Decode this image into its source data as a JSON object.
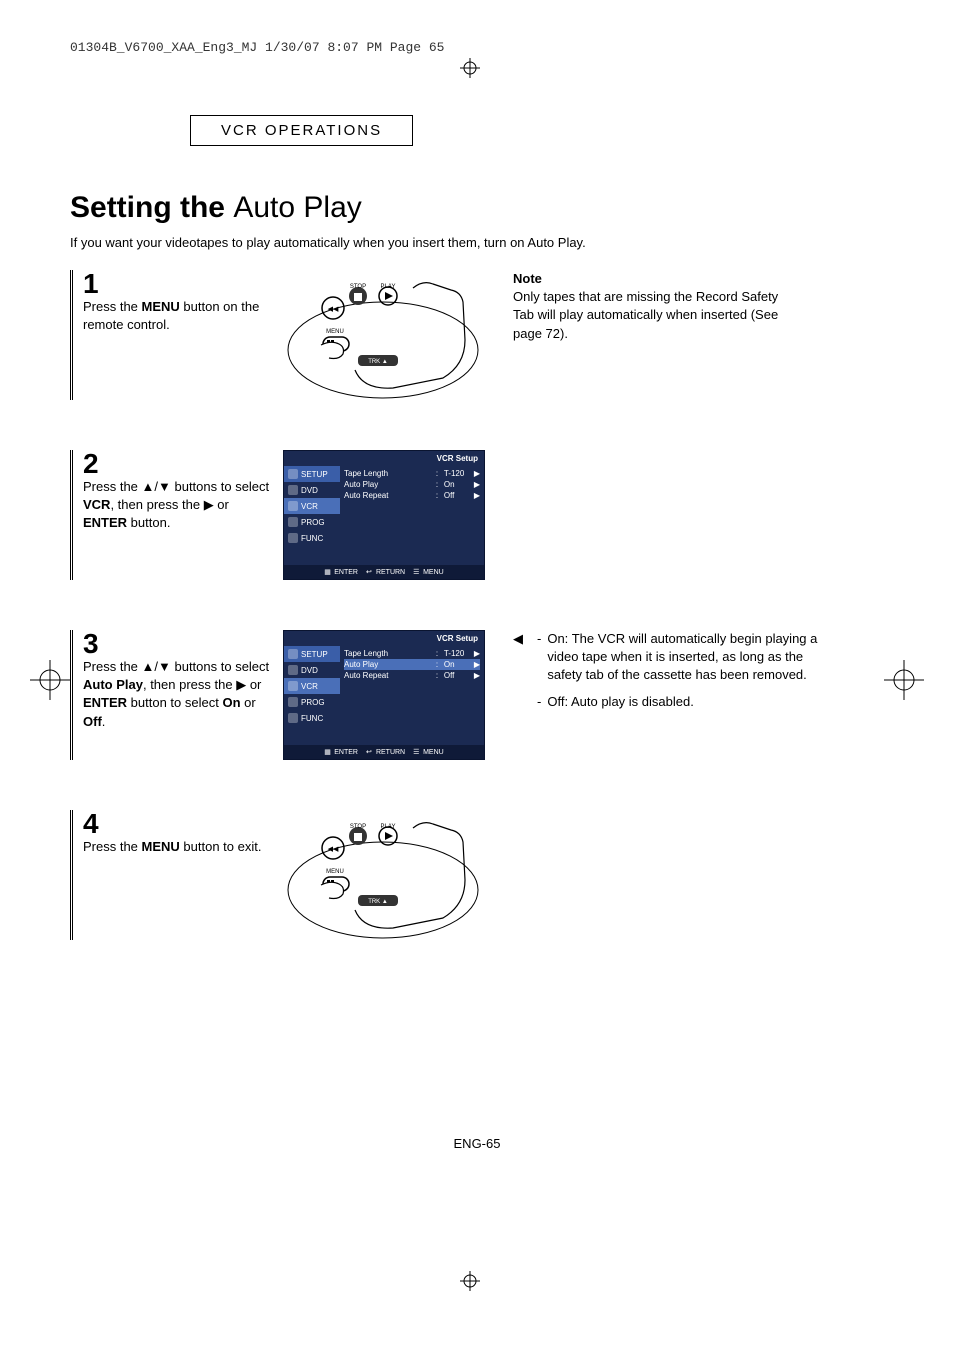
{
  "header_line": "01304B_V6700_XAA_Eng3_MJ  1/30/07  8:07 PM  Page 65",
  "section": "VCR OPERATIONS",
  "title_bold": "Setting the",
  "title_thin": "Auto Play",
  "intro": "If you want your videotapes to play automatically when you insert them, turn on Auto Play.",
  "step1": {
    "num": "1",
    "text_before": "Press the ",
    "bold1": "MENU",
    "text_after": " button on the remote control."
  },
  "note": {
    "head": "Note",
    "body": "Only tapes that are missing the Record Safety Tab will play automatically when inserted (See page 72)."
  },
  "step2": {
    "num": "2",
    "line1": "Press the ▲/▼ buttons to select ",
    "bold1": "VCR",
    "line2": ", then press the ",
    "symbol": "▶",
    "line3": " or ",
    "bold2": "ENTER",
    "line4": " button."
  },
  "step3": {
    "num": "3",
    "line1": "Press the ▲/▼ buttons to select ",
    "bold1": "Auto Play",
    "line2": ", then press the ",
    "symbol": "▶",
    "line3": " or ",
    "bold2": "ENTER",
    "line4": " button to select ",
    "bold3": "On",
    "line5": " or ",
    "bold4": "Off",
    "line6": "."
  },
  "options": {
    "on_label": "On:",
    "on_text": "The VCR will automatically begin playing a video tape when it is inserted, as long as the safety tab of the cassette has been removed.",
    "off_label": "Off:",
    "off_text": "Auto play is disabled."
  },
  "step4": {
    "num": "4",
    "line1": "Press the ",
    "bold1": "MENU",
    "line2": " button to exit."
  },
  "page_num": "ENG-65",
  "remote_labels": {
    "stop": "STOP",
    "play": "PLAY",
    "menu": "MENU",
    "trk": "TRK ▲"
  },
  "osd": {
    "title": "VCR Setup",
    "tabs": [
      "SETUP",
      "DVD",
      "VCR",
      "PROG",
      "FUNC"
    ],
    "rows": [
      {
        "label": "Tape Length",
        "value": "T-120"
      },
      {
        "label": "Auto Play",
        "value": "On"
      },
      {
        "label": "Auto Repeat",
        "value": "Off"
      }
    ],
    "footer": [
      "ENTER",
      "RETURN",
      "MENU"
    ]
  }
}
